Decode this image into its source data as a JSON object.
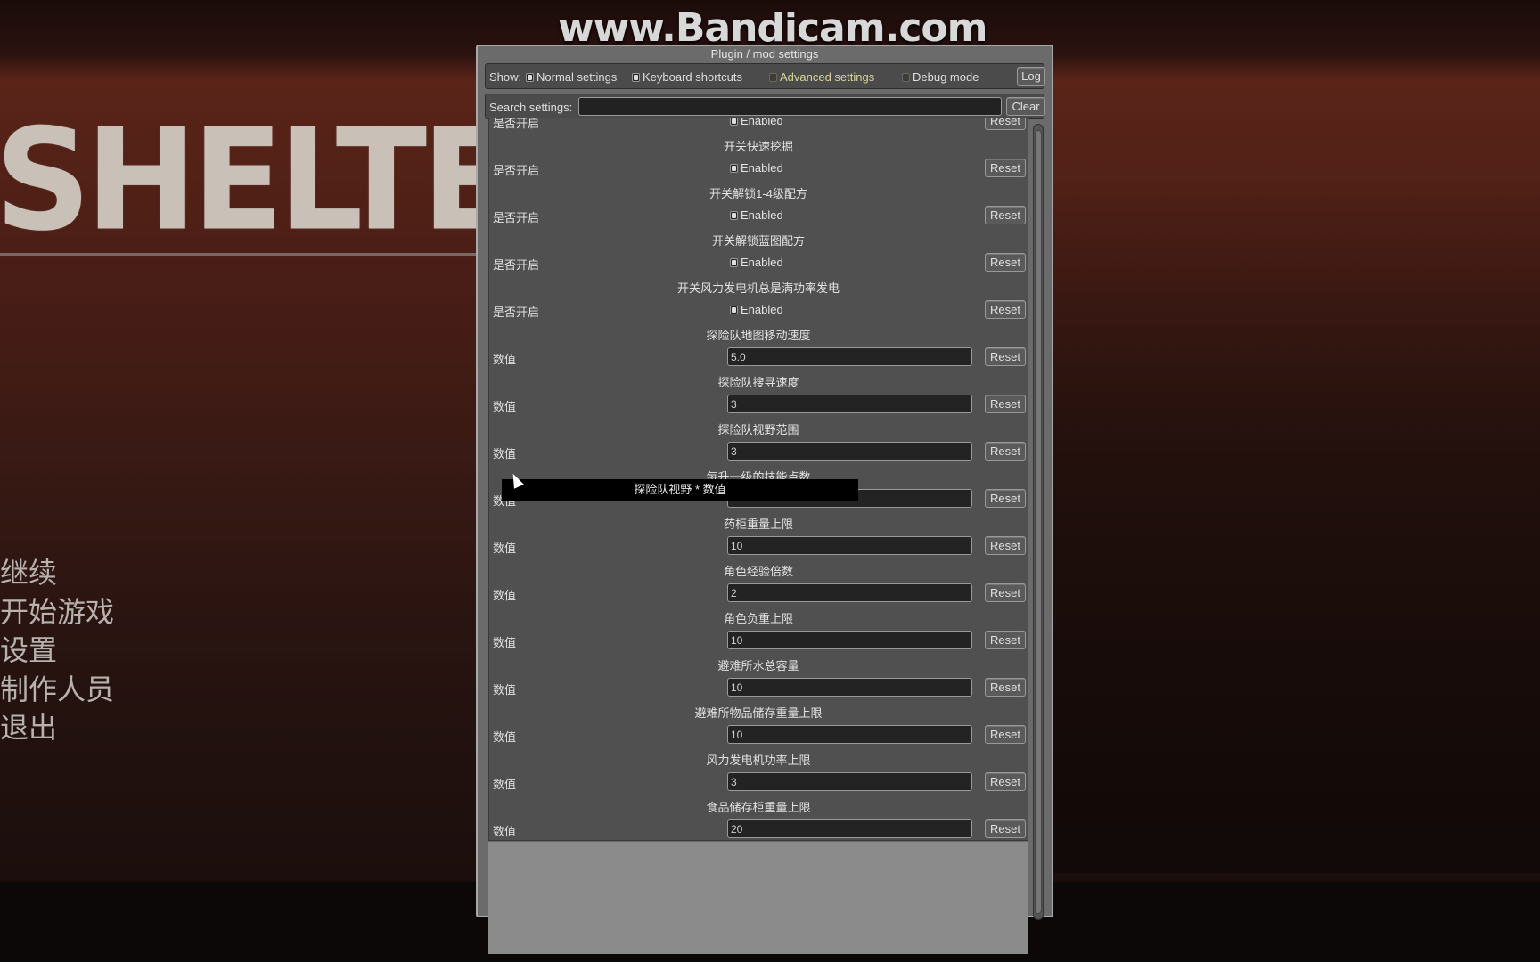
{
  "watermark": "www.Bandicam.com",
  "background": {
    "logo": "SHELTE",
    "menu": [
      "继续",
      "开始游戏",
      "设置",
      "制作人员",
      "退出"
    ]
  },
  "panel": {
    "title": "Plugin / mod settings",
    "show_label": "Show:",
    "filters": [
      {
        "label": "Normal settings",
        "checked": true
      },
      {
        "label": "Keyboard shortcuts",
        "checked": true
      },
      {
        "label": "Advanced settings",
        "checked": false,
        "color": "#d8d49a"
      },
      {
        "label": "Debug mode",
        "checked": false
      }
    ],
    "log_label": "Log",
    "search_label": "Search settings:",
    "search_value": "",
    "clear_label": "Clear",
    "reset_label": "Reset",
    "items": [
      {
        "header": "",
        "label": "是否开启",
        "type": "toggle",
        "value": "Enabled"
      },
      {
        "header": "开关快速挖掘",
        "label": "是否开启",
        "type": "toggle",
        "value": "Enabled"
      },
      {
        "header": "开关解锁1-4级配方",
        "label": "是否开启",
        "type": "toggle",
        "value": "Enabled"
      },
      {
        "header": "开关解锁蓝图配方",
        "label": "是否开启",
        "type": "toggle",
        "value": "Enabled"
      },
      {
        "header": "开关风力发电机总是满功率发电",
        "label": "是否开启",
        "type": "toggle",
        "value": "Enabled"
      },
      {
        "header": "探险队地图移动速度",
        "label": "数值",
        "type": "text",
        "value": "5.0"
      },
      {
        "header": "探险队搜寻速度",
        "label": "数值",
        "type": "text",
        "value": "3"
      },
      {
        "header": "探险队视野范围",
        "label": "数值",
        "type": "text",
        "value": "3"
      },
      {
        "header": "每升一级的技能点数",
        "label": "数值",
        "type": "text",
        "value": ""
      },
      {
        "header": "药柜重量上限",
        "label": "数值",
        "type": "text",
        "value": "10"
      },
      {
        "header": "角色经验倍数",
        "label": "数值",
        "type": "text",
        "value": "2"
      },
      {
        "header": "角色负重上限",
        "label": "数值",
        "type": "text",
        "value": "10"
      },
      {
        "header": "避难所水总容量",
        "label": "数值",
        "type": "text",
        "value": "10"
      },
      {
        "header": "避难所物品储存重量上限",
        "label": "数值",
        "type": "text",
        "value": "10"
      },
      {
        "header": "风力发电机功率上限",
        "label": "数值",
        "type": "text",
        "value": "3"
      },
      {
        "header": "食品储存柜重量上限",
        "label": "数值",
        "type": "text",
        "value": "20"
      }
    ],
    "tooltip": "探险队视野 * 数值"
  }
}
